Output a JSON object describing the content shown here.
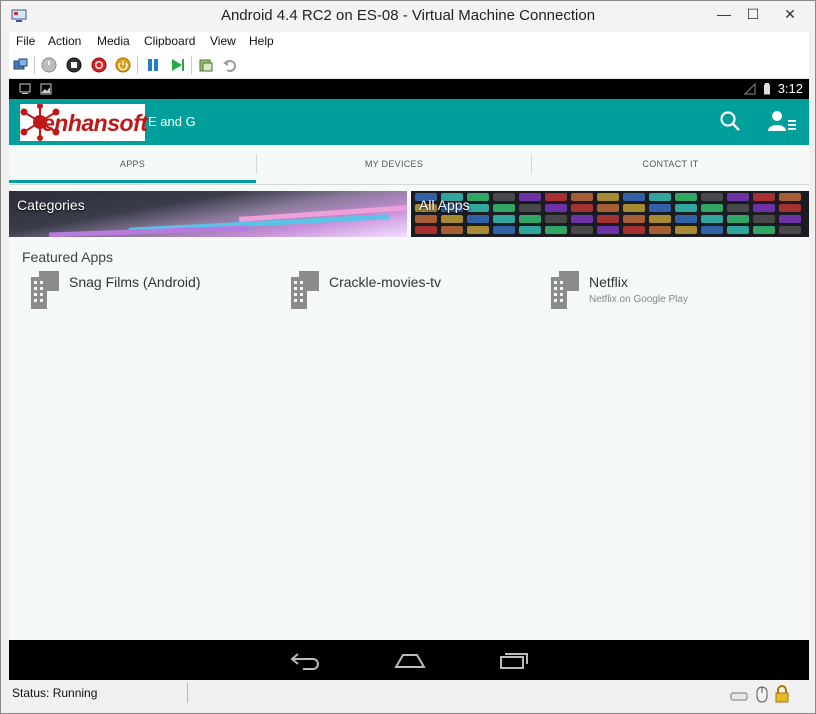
{
  "window": {
    "title": "Android 4.4 RC2 on ES-08 - Virtual Machine Connection",
    "minimize_glyph": "—",
    "maximize_glyph": "☐",
    "close_glyph": "✕"
  },
  "menu": [
    "File",
    "Action",
    "Media",
    "Clipboard",
    "View",
    "Help"
  ],
  "toolbar_icons": [
    "ctrl-alt-del-icon",
    "start-icon",
    "turn-off-icon",
    "shut-down-icon",
    "power-save-icon",
    "pause-icon",
    "resume-icon",
    "snapshot-icon",
    "revert-icon"
  ],
  "android": {
    "status_time": "3:12",
    "app_name": "E and G",
    "logo_text": "enhansoft",
    "tabs": [
      "APPS",
      "MY DEVICES",
      "CONTACT IT"
    ],
    "active_tab": 0,
    "banners": {
      "categories": "Categories",
      "all_apps": "All Apps"
    },
    "featured_title": "Featured Apps",
    "apps": [
      {
        "name": "Snag Films (Android)",
        "subtitle": ""
      },
      {
        "name": "Crackle-movies-tv",
        "subtitle": ""
      },
      {
        "name": "Netflix",
        "subtitle": "Netflix on Google Play"
      }
    ],
    "nav_buttons": [
      "back-icon",
      "home-icon",
      "recent-apps-icon"
    ]
  },
  "status": {
    "text": "Status: Running"
  },
  "colors": {
    "accent": "#009f9b",
    "logo_red": "#c01818"
  }
}
